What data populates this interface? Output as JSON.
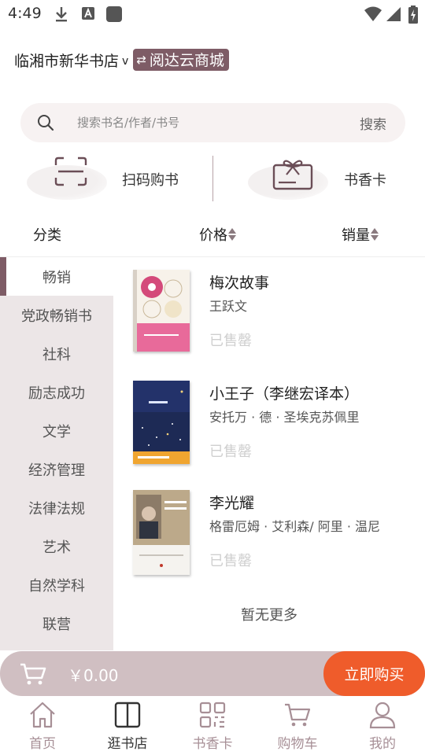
{
  "status_bar": {
    "time": "4:49",
    "icons": [
      "download-icon",
      "font-icon",
      "app-icon",
      "wifi-icon",
      "signal-icon",
      "battery-charging-icon"
    ]
  },
  "header": {
    "store_name": "临湘市新华书店",
    "caret": "v",
    "switch_icon": "⇄",
    "switch_label": "阅达云商城"
  },
  "search": {
    "placeholder": "搜索书名/作者/书号",
    "value": "",
    "button_label": "搜索"
  },
  "quick_actions": [
    {
      "icon": "scan-icon",
      "label": "扫码购书"
    },
    {
      "icon": "gift-card-icon",
      "label": "书香卡"
    }
  ],
  "sort": {
    "category_label": "分类",
    "price_label": "价格",
    "sales_label": "销量"
  },
  "categories": [
    "畅销",
    "党政畅销书",
    "社科",
    "励志成功",
    "文学",
    "经济管理",
    "法律法规",
    "艺术",
    "自然学科",
    "联营"
  ],
  "active_category": "畅销",
  "books": [
    {
      "title": "梅次故事",
      "author": "王跃文",
      "status": "已售罄"
    },
    {
      "title": "小王子（李继宏译本）",
      "author": "安托万 · 德 · 圣埃克苏佩里",
      "status": "已售罄"
    },
    {
      "title": "李光耀",
      "author": "格雷厄姆 · 艾利森/ 阿里 · 温尼",
      "status": "已售罄"
    }
  ],
  "no_more": "暂无更多",
  "cart": {
    "amount": "￥0.00",
    "buy_label": "立即购买"
  },
  "nav": [
    {
      "icon": "home-icon",
      "label": "首页"
    },
    {
      "icon": "store-icon",
      "label": "逛书店"
    },
    {
      "icon": "qr-card-icon",
      "label": "书香卡"
    },
    {
      "icon": "cart-icon",
      "label": "购物车"
    },
    {
      "icon": "user-icon",
      "label": "我的"
    }
  ],
  "colors": {
    "brand": "#7e5c66",
    "sidebar_bg": "#ece6e7",
    "cart_bar": "#d0bfc2",
    "buy_button": "#ef5c2b",
    "nav_inactive": "#a78f96"
  }
}
